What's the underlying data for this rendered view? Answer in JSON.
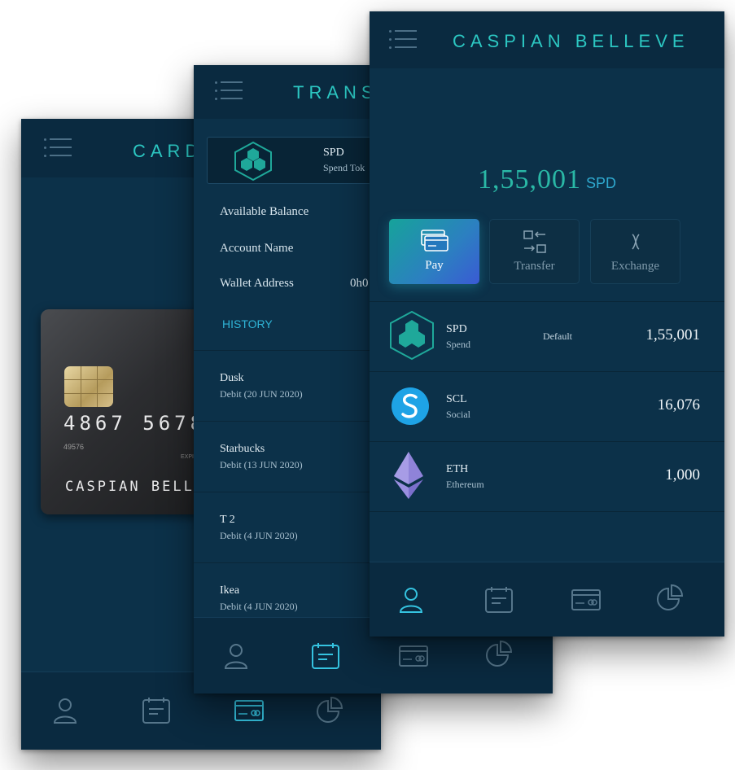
{
  "cards_screen": {
    "title": "CARD",
    "card": {
      "number": "4867 5678",
      "small_number": "49576",
      "exp_label": "EXPI",
      "holder": "CASPIAN BELL"
    }
  },
  "transactions_screen": {
    "title": "TRANS",
    "token": {
      "symbol": "SPD",
      "name": "Spend Tok"
    },
    "fields": [
      {
        "label": "Available Balance",
        "value": ""
      },
      {
        "label": "Account Name",
        "value": ""
      },
      {
        "label": "Wallet Address",
        "value": "0h0"
      }
    ],
    "history_label": "HISTORY",
    "transactions": [
      {
        "name": "Dusk",
        "detail": "Debit (20 JUN 2020)"
      },
      {
        "name": "Starbucks",
        "detail": "Debit (13 JUN 2020)"
      },
      {
        "name": "T 2",
        "detail": "Debit (4 JUN 2020)"
      },
      {
        "name": "Ikea",
        "detail": "Debit (4 JUN 2020)"
      }
    ]
  },
  "wallet_screen": {
    "title": "CASPIAN BELLEVE",
    "balance": {
      "amount": "1,55,001",
      "currency": "SPD"
    },
    "actions": [
      {
        "label": "Pay",
        "icon": "cards-icon"
      },
      {
        "label": "Transfer",
        "icon": "transfer-icon"
      },
      {
        "label": "Exchange",
        "icon": "exchange-icon"
      }
    ],
    "assets": [
      {
        "symbol": "SPD",
        "name": "Spend",
        "tag": "Default",
        "value": "1,55,001",
        "icon": "spd-hex-logo"
      },
      {
        "symbol": "SCL",
        "name": "Social",
        "tag": "",
        "value": "16,076",
        "icon": "scl-logo"
      },
      {
        "symbol": "ETH",
        "name": "Ethereum",
        "tag": "",
        "value": "1,000",
        "icon": "eth-logo"
      }
    ]
  },
  "nav": [
    "profile-icon",
    "transactions-icon",
    "card-icon",
    "analytics-icon"
  ],
  "colors": {
    "background": "#0c3149",
    "bar": "#0a2a40",
    "accent_teal": "#2cc7c2",
    "accent_blue": "#2fa9cf"
  }
}
